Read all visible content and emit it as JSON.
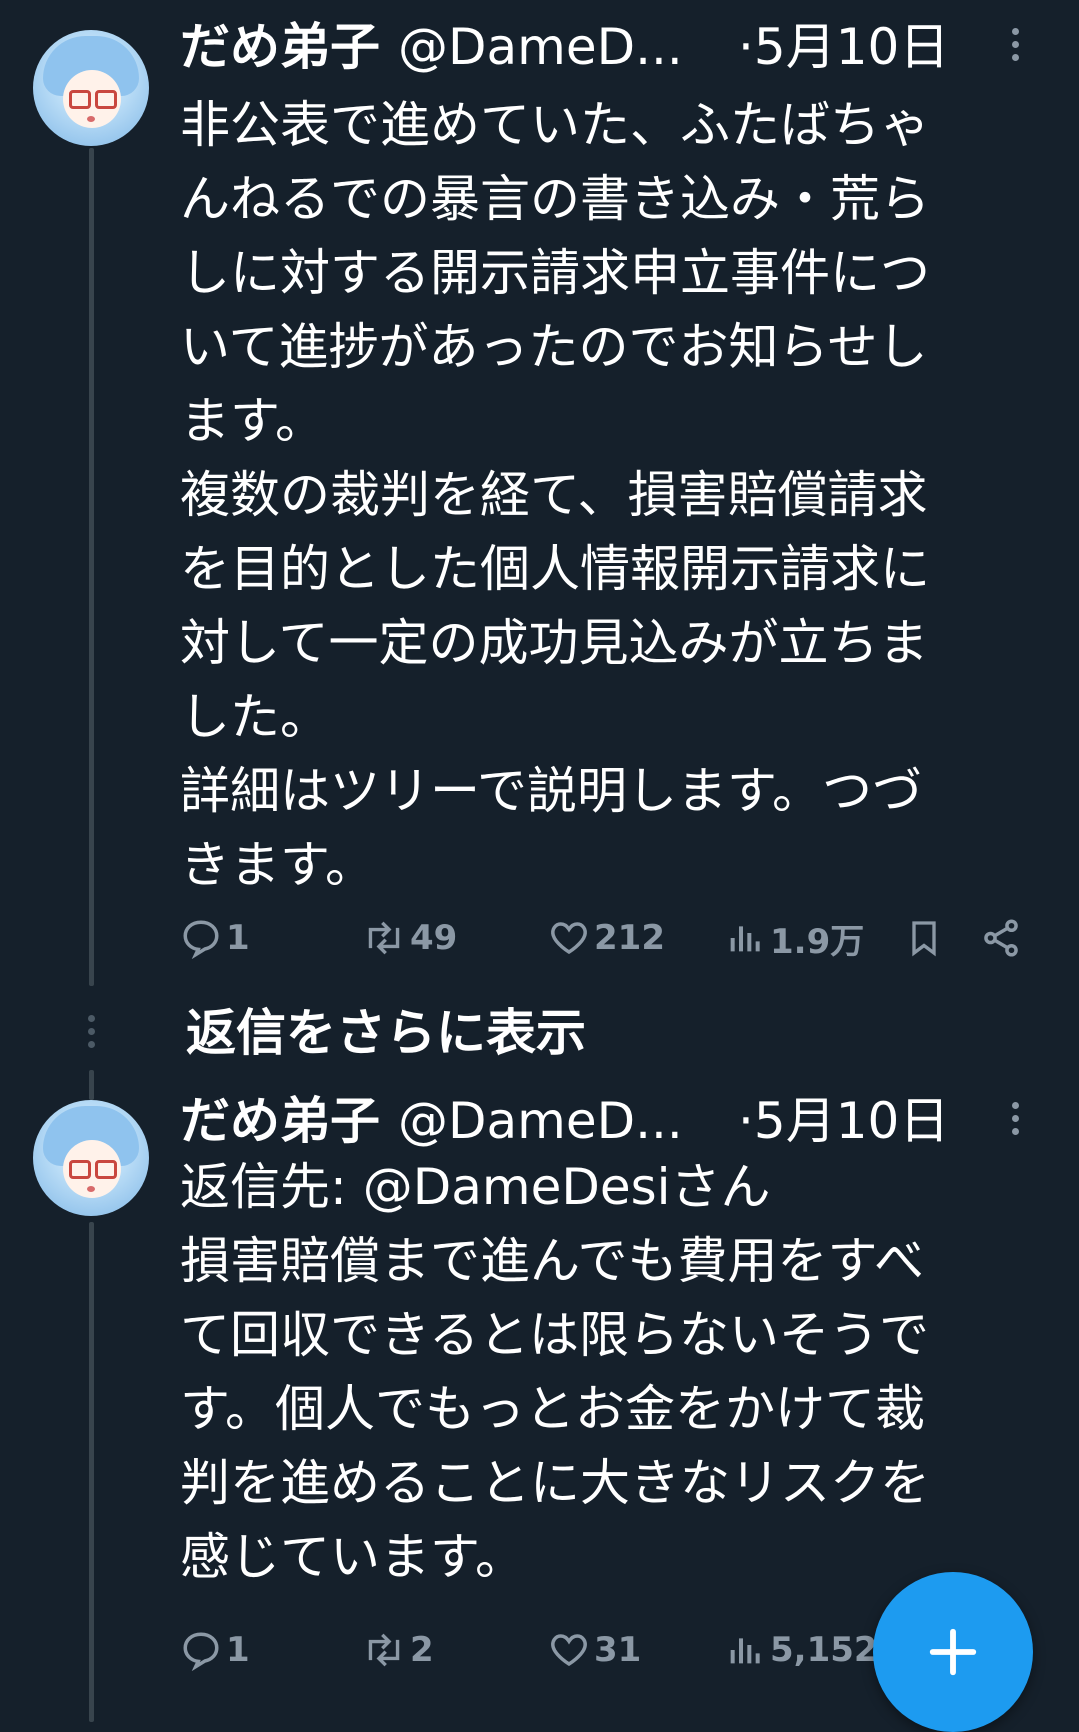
{
  "tweets": [
    {
      "name": "だめ弟子",
      "handle": "@DameD...",
      "date": "·5月10日",
      "lines": [
        "非公表で進めていた、ふたばちゃ",
        "んねるでの暴言の書き込み・荒ら",
        "しに対する開示請求申立事件につ",
        "いて進捗があったのでお知らせし",
        "ます。",
        "複数の裁判を経て、損害賠償請求",
        "を目的とした個人情報開示請求に",
        "対して一定の成功見込みが立ちま",
        "した。",
        "詳細はツリーで説明します。つづ",
        "きます。"
      ],
      "replies": "1",
      "retweets": "49",
      "likes": "212",
      "views": "1.9万"
    },
    {
      "name": "だめ弟子",
      "handle": "@DameD...",
      "date": "·5月10日",
      "reply_to": "返信先: @DameDesiさん",
      "lines": [
        "損害賠償まで進んでも費用をすべ",
        "て回収できるとは限らないそうで",
        "す。個人でもっとお金をかけて裁",
        "判を進めることに大きなリスクを",
        "感じています。"
      ],
      "replies": "1",
      "retweets": "2",
      "likes": "31",
      "views": "5,152"
    }
  ],
  "show_more_replies": "返信をさらに表示",
  "icons": {
    "reply": "reply-icon",
    "retweet": "retweet-icon",
    "like": "heart-icon",
    "views": "views-icon",
    "bookmark": "bookmark-icon",
    "share": "share-icon",
    "compose": "plus-icon"
  },
  "colors": {
    "background": "#15202b",
    "accent": "#1d9bf0",
    "muted": "#8b98a5"
  }
}
